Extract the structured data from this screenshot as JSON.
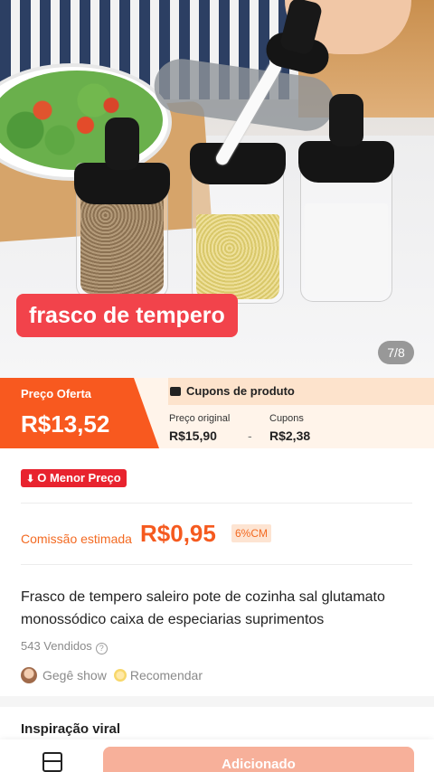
{
  "hero": {
    "overlay_label": "frasco de tempero",
    "image_counter": "7/8"
  },
  "price": {
    "offer_label": "Preço Oferta",
    "offer_value": "R$13,52",
    "coupons_header": "Cupons de produto",
    "original_label": "Preço original",
    "original_value": "R$15,90",
    "separator": "-",
    "coupons_label": "Cupons",
    "coupons_value": "R$2,38"
  },
  "badge": {
    "label": "O Menor Preço"
  },
  "commission": {
    "label": "Comissão estimada",
    "value": "R$0,95",
    "percent": "6%CM"
  },
  "product": {
    "title": "Frasco de tempero saleiro pote de cozinha sal glutamato monossódico caixa de especiarias suprimentos",
    "sold": "543 Vendidos",
    "author": "Gegê show",
    "recommend": "Recomendar"
  },
  "section": {
    "title": "Inspiração viral"
  },
  "bottom": {
    "add_label": "Adicionado"
  },
  "colors": {
    "accent": "#f8591f",
    "badge": "#e8232e",
    "overlay": "#f2434b"
  }
}
